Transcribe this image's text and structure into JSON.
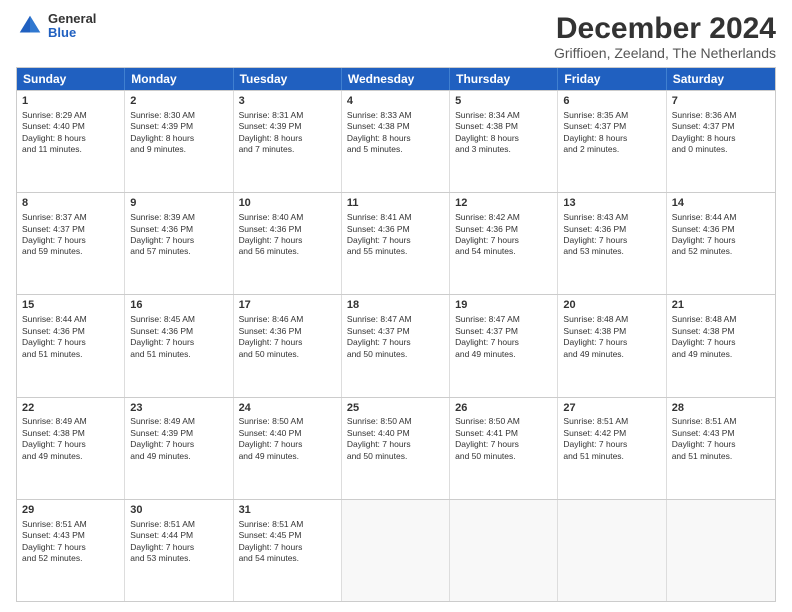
{
  "logo": {
    "general": "General",
    "blue": "Blue"
  },
  "title": "December 2024",
  "subtitle": "Griffioen, Zeeland, The Netherlands",
  "days_of_week": [
    "Sunday",
    "Monday",
    "Tuesday",
    "Wednesday",
    "Thursday",
    "Friday",
    "Saturday"
  ],
  "weeks": [
    [
      {
        "day": "1",
        "info": "Sunrise: 8:29 AM\nSunset: 4:40 PM\nDaylight: 8 hours\nand 11 minutes."
      },
      {
        "day": "2",
        "info": "Sunrise: 8:30 AM\nSunset: 4:39 PM\nDaylight: 8 hours\nand 9 minutes."
      },
      {
        "day": "3",
        "info": "Sunrise: 8:31 AM\nSunset: 4:39 PM\nDaylight: 8 hours\nand 7 minutes."
      },
      {
        "day": "4",
        "info": "Sunrise: 8:33 AM\nSunset: 4:38 PM\nDaylight: 8 hours\nand 5 minutes."
      },
      {
        "day": "5",
        "info": "Sunrise: 8:34 AM\nSunset: 4:38 PM\nDaylight: 8 hours\nand 3 minutes."
      },
      {
        "day": "6",
        "info": "Sunrise: 8:35 AM\nSunset: 4:37 PM\nDaylight: 8 hours\nand 2 minutes."
      },
      {
        "day": "7",
        "info": "Sunrise: 8:36 AM\nSunset: 4:37 PM\nDaylight: 8 hours\nand 0 minutes."
      }
    ],
    [
      {
        "day": "8",
        "info": "Sunrise: 8:37 AM\nSunset: 4:37 PM\nDaylight: 7 hours\nand 59 minutes."
      },
      {
        "day": "9",
        "info": "Sunrise: 8:39 AM\nSunset: 4:36 PM\nDaylight: 7 hours\nand 57 minutes."
      },
      {
        "day": "10",
        "info": "Sunrise: 8:40 AM\nSunset: 4:36 PM\nDaylight: 7 hours\nand 56 minutes."
      },
      {
        "day": "11",
        "info": "Sunrise: 8:41 AM\nSunset: 4:36 PM\nDaylight: 7 hours\nand 55 minutes."
      },
      {
        "day": "12",
        "info": "Sunrise: 8:42 AM\nSunset: 4:36 PM\nDaylight: 7 hours\nand 54 minutes."
      },
      {
        "day": "13",
        "info": "Sunrise: 8:43 AM\nSunset: 4:36 PM\nDaylight: 7 hours\nand 53 minutes."
      },
      {
        "day": "14",
        "info": "Sunrise: 8:44 AM\nSunset: 4:36 PM\nDaylight: 7 hours\nand 52 minutes."
      }
    ],
    [
      {
        "day": "15",
        "info": "Sunrise: 8:44 AM\nSunset: 4:36 PM\nDaylight: 7 hours\nand 51 minutes."
      },
      {
        "day": "16",
        "info": "Sunrise: 8:45 AM\nSunset: 4:36 PM\nDaylight: 7 hours\nand 51 minutes."
      },
      {
        "day": "17",
        "info": "Sunrise: 8:46 AM\nSunset: 4:36 PM\nDaylight: 7 hours\nand 50 minutes."
      },
      {
        "day": "18",
        "info": "Sunrise: 8:47 AM\nSunset: 4:37 PM\nDaylight: 7 hours\nand 50 minutes."
      },
      {
        "day": "19",
        "info": "Sunrise: 8:47 AM\nSunset: 4:37 PM\nDaylight: 7 hours\nand 49 minutes."
      },
      {
        "day": "20",
        "info": "Sunrise: 8:48 AM\nSunset: 4:38 PM\nDaylight: 7 hours\nand 49 minutes."
      },
      {
        "day": "21",
        "info": "Sunrise: 8:48 AM\nSunset: 4:38 PM\nDaylight: 7 hours\nand 49 minutes."
      }
    ],
    [
      {
        "day": "22",
        "info": "Sunrise: 8:49 AM\nSunset: 4:38 PM\nDaylight: 7 hours\nand 49 minutes."
      },
      {
        "day": "23",
        "info": "Sunrise: 8:49 AM\nSunset: 4:39 PM\nDaylight: 7 hours\nand 49 minutes."
      },
      {
        "day": "24",
        "info": "Sunrise: 8:50 AM\nSunset: 4:40 PM\nDaylight: 7 hours\nand 49 minutes."
      },
      {
        "day": "25",
        "info": "Sunrise: 8:50 AM\nSunset: 4:40 PM\nDaylight: 7 hours\nand 50 minutes."
      },
      {
        "day": "26",
        "info": "Sunrise: 8:50 AM\nSunset: 4:41 PM\nDaylight: 7 hours\nand 50 minutes."
      },
      {
        "day": "27",
        "info": "Sunrise: 8:51 AM\nSunset: 4:42 PM\nDaylight: 7 hours\nand 51 minutes."
      },
      {
        "day": "28",
        "info": "Sunrise: 8:51 AM\nSunset: 4:43 PM\nDaylight: 7 hours\nand 51 minutes."
      }
    ],
    [
      {
        "day": "29",
        "info": "Sunrise: 8:51 AM\nSunset: 4:43 PM\nDaylight: 7 hours\nand 52 minutes."
      },
      {
        "day": "30",
        "info": "Sunrise: 8:51 AM\nSunset: 4:44 PM\nDaylight: 7 hours\nand 53 minutes."
      },
      {
        "day": "31",
        "info": "Sunrise: 8:51 AM\nSunset: 4:45 PM\nDaylight: 7 hours\nand 54 minutes."
      },
      {
        "day": "",
        "info": ""
      },
      {
        "day": "",
        "info": ""
      },
      {
        "day": "",
        "info": ""
      },
      {
        "day": "",
        "info": ""
      }
    ]
  ]
}
